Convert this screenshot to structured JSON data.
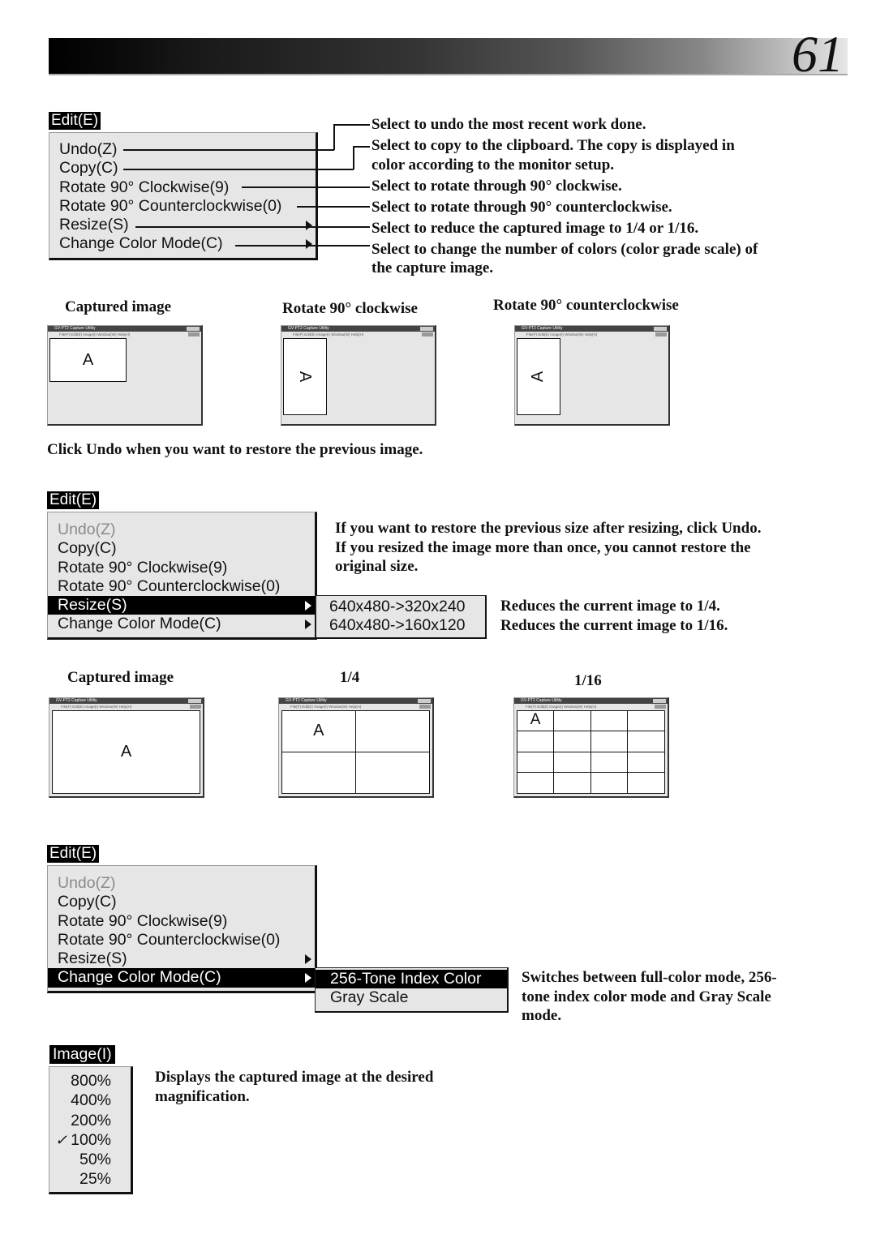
{
  "page": {
    "number": "61"
  },
  "section1": {
    "menu_title": "Edit(E)",
    "items": [
      {
        "label": "Undo(Z)",
        "has_submenu": false,
        "state": "normal"
      },
      {
        "label": "Copy(C)",
        "has_submenu": false,
        "state": "normal"
      },
      {
        "label": "Rotate 90° Clockwise(9)",
        "has_submenu": false,
        "state": "normal"
      },
      {
        "label": "Rotate 90° Counterclockwise(0)",
        "has_submenu": false,
        "state": "normal"
      },
      {
        "label": "Resize(S)",
        "has_submenu": true,
        "state": "normal"
      },
      {
        "label": "Change Color Mode(C)",
        "has_submenu": true,
        "state": "normal"
      }
    ],
    "descriptions": [
      "Select to undo the most recent work done.",
      "Select to copy to the clipboard.  The copy is displayed in",
      "color according to the monitor setup.",
      "Select to rotate through 90° clockwise.",
      "Select to rotate through 90° counterclockwise.",
      "Select to reduce the captured image to 1/4 or 1/16.",
      "Select to change the number of colors (color grade scale) of",
      "the capture image."
    ],
    "captions": [
      "Captured image",
      "Rotate 90° clockwise",
      "Rotate 90° counterclockwise"
    ],
    "note": "Click Undo when you want to restore the previous image."
  },
  "mini_window": {
    "title": "GV-PT2 Capture Utility",
    "menu": "File(F)  Edit(E)  Image(I)  Window(W)  Help(H)",
    "glyph": "A"
  },
  "section2": {
    "menu_title": "Edit(E)",
    "items": [
      {
        "label": "Undo(Z)",
        "state": "disabled"
      },
      {
        "label": "Copy(C)",
        "state": "normal"
      },
      {
        "label": "Rotate 90° Clockwise(9)",
        "state": "normal"
      },
      {
        "label": "Rotate 90° Counterclockwise(0)",
        "state": "normal"
      },
      {
        "label": "Resize(S)",
        "state": "selected",
        "has_submenu": true
      },
      {
        "label": "Change Color Mode(C)",
        "state": "normal",
        "has_submenu": true
      }
    ],
    "submenu": [
      "640x480->320x240",
      "640x480->160x120"
    ],
    "intro": [
      "If you want to restore the previous size after resizing, click Undo.",
      "If you resized the image more than once, you cannot restore the",
      "original size."
    ],
    "sub_descriptions": [
      "Reduces the current image to 1/4.",
      "Reduces the current image to 1/16."
    ],
    "captions": [
      "Captured image",
      "1/4",
      "1/16"
    ]
  },
  "section3": {
    "menu_title": "Edit(E)",
    "items": [
      {
        "label": "Undo(Z)",
        "state": "disabled"
      },
      {
        "label": "Copy(C)",
        "state": "normal"
      },
      {
        "label": "Rotate 90° Clockwise(9)",
        "state": "normal"
      },
      {
        "label": "Rotate 90° Counterclockwise(0)",
        "state": "normal"
      },
      {
        "label": "Resize(S)",
        "state": "normal",
        "has_submenu": true
      },
      {
        "label": "Change Color Mode(C)",
        "state": "selected",
        "has_submenu": true
      }
    ],
    "submenu": [
      {
        "label": "256-Tone Index Color",
        "state": "selected"
      },
      {
        "label": "Gray Scale",
        "state": "normal"
      }
    ],
    "description": [
      "Switches between full-color mode, 256-",
      "tone index color mode and Gray Scale",
      "mode."
    ]
  },
  "section4": {
    "menu_title": "Image(I)",
    "items": [
      {
        "label": "800%",
        "checked": false
      },
      {
        "label": "400%",
        "checked": false
      },
      {
        "label": "200%",
        "checked": false
      },
      {
        "label": "100%",
        "checked": true
      },
      {
        "label": "50%",
        "checked": false
      },
      {
        "label": "25%",
        "checked": false
      }
    ],
    "check_glyph": "✓",
    "description": [
      "Displays the captured image at the desired",
      "magnification."
    ]
  }
}
